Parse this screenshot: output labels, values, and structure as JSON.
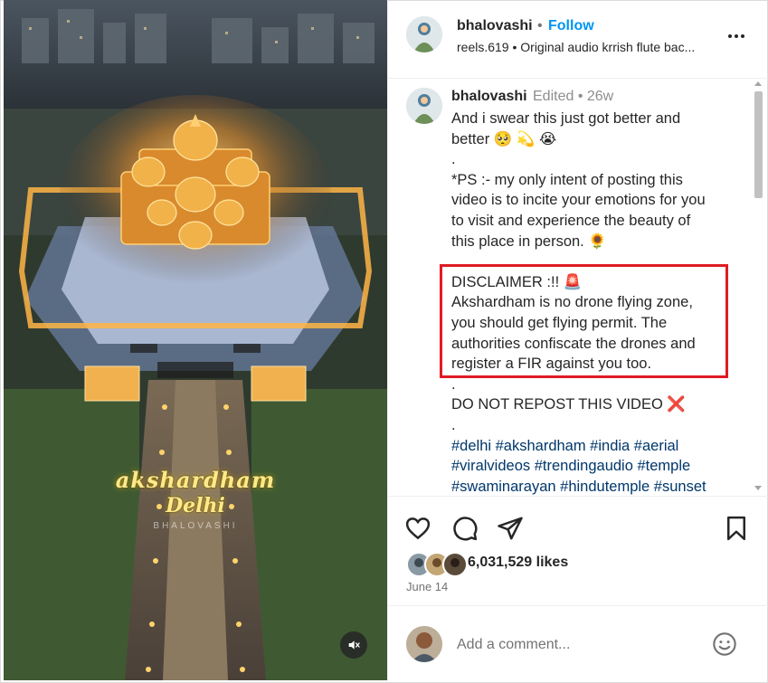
{
  "header": {
    "username": "bhalovashi",
    "separator": "•",
    "follow_label": "Follow",
    "audio_line": "reels.619 • Original audio krrish flute bac..."
  },
  "caption": {
    "username": "bhalovashi",
    "meta": "Edited •  26w",
    "lines": [
      "And i swear this just got better and",
      "better 🥺 💫 😭",
      ".",
      "*PS :- my only intent of posting this",
      "video is to incite your emotions for you",
      "to visit and experience the beauty of",
      "this place in person. 🌻",
      "",
      "DISCLAIMER :!! 🚨",
      "Akshardham is no drone flying zone,",
      "you should get flying permit. The",
      "authorities confiscate the drones and",
      "register a FIR against you too.",
      ".",
      "DO NOT REPOST THIS VIDEO",
      "."
    ],
    "repost_mark": "❌",
    "hashtags": [
      "#delhi #akshardham #india #aerial",
      "#viralvideos #trendingaudio #temple",
      "#swaminarayan #hindutemple #sunset"
    ]
  },
  "video": {
    "overlay_title": "akshardham",
    "overlay_subtitle": "Delhi",
    "watermark": "BHALOVASHI"
  },
  "actions": {
    "likes": "6,031,529 likes",
    "date": "June 14"
  },
  "comment": {
    "placeholder": "Add a comment..."
  },
  "colors": {
    "follow": "#0095f6",
    "hashtag": "#00376b",
    "highlight_box": "#e01b24",
    "temple_glow": "#ffb547"
  },
  "icons": [
    "heart-icon",
    "comment-icon",
    "share-icon",
    "bookmark-icon",
    "mute-icon",
    "emoji-icon",
    "more-options-icon"
  ]
}
